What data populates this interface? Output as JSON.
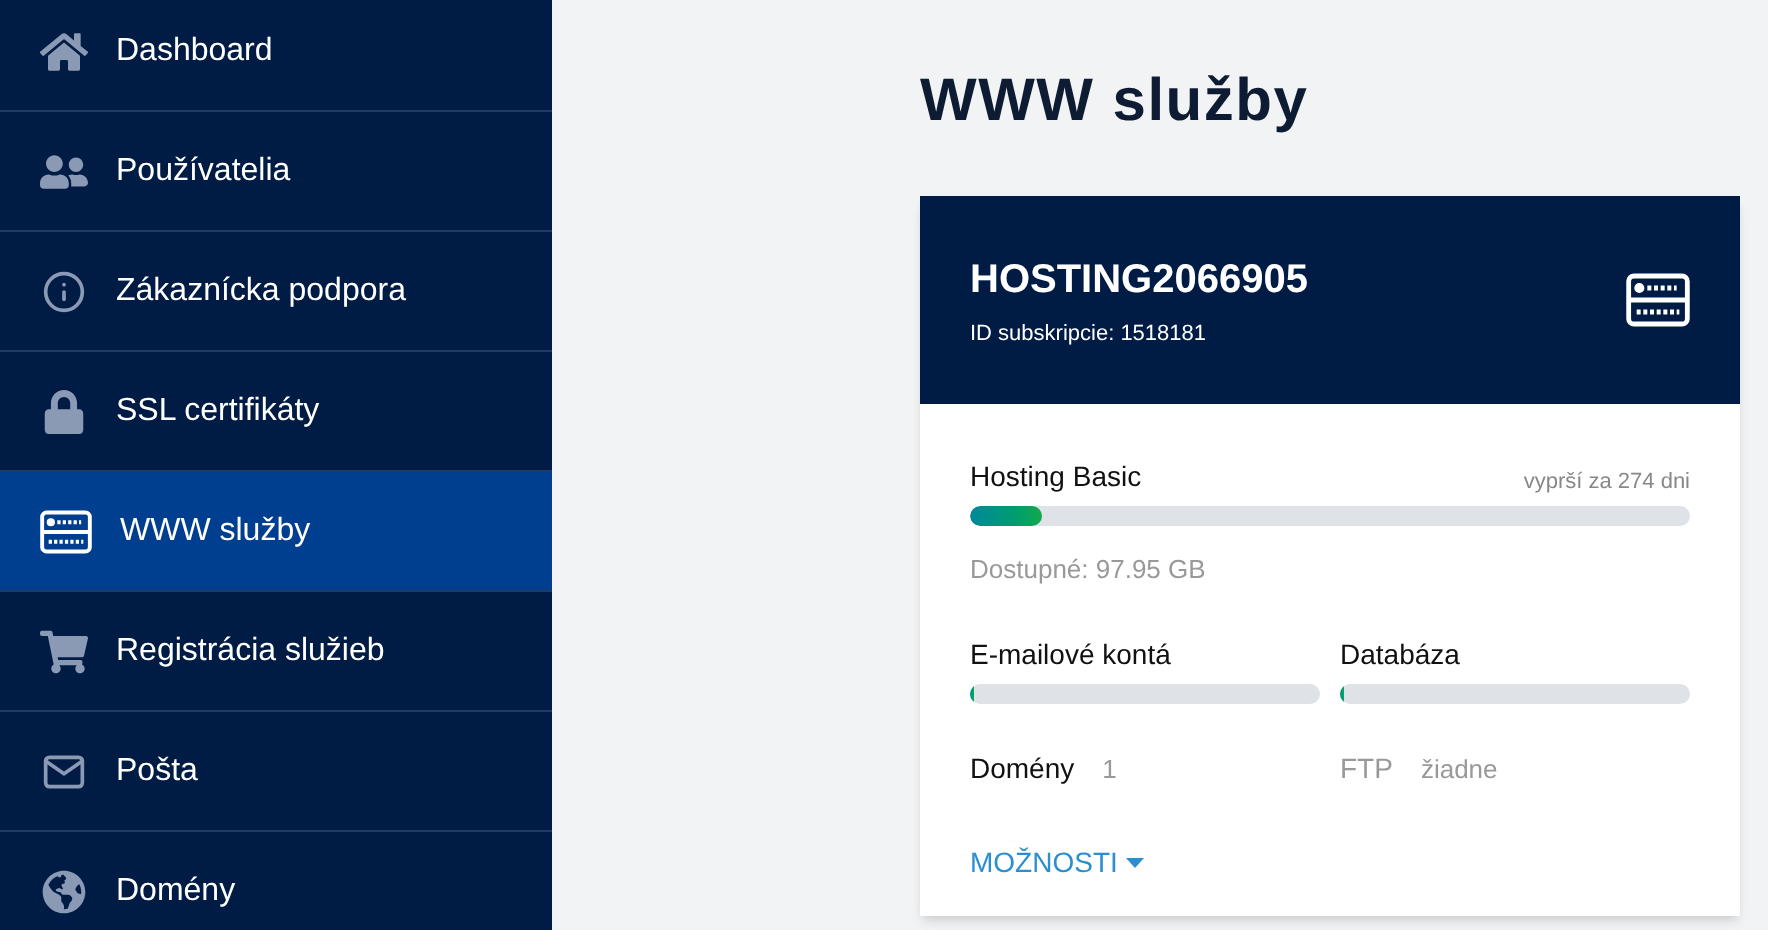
{
  "sidebar": {
    "items": [
      {
        "label": "Dashboard",
        "selected": false
      },
      {
        "label": "Používatelia",
        "selected": false
      },
      {
        "label": "Zákaznícka podpora",
        "selected": false
      },
      {
        "label": "SSL certifikáty",
        "selected": false
      },
      {
        "label": "WWW služby",
        "selected": true
      },
      {
        "label": "Registrácia služieb",
        "selected": false
      },
      {
        "label": "Pošta",
        "selected": false
      },
      {
        "label": "Domény",
        "selected": false
      }
    ]
  },
  "page_title": "WWW služby",
  "card": {
    "name": "HOSTING2066905",
    "subtitle": "ID subskripcie: 1518181",
    "plan": {
      "label": "Hosting Basic",
      "expiry": "vyprší za 274 dni",
      "level": 0.1,
      "available": "Dostupné: 97.95 GB"
    },
    "meters": [
      {
        "label": "E-mailové kontá",
        "level": 0.005
      },
      {
        "label": "Databáza",
        "level": 0.005
      }
    ],
    "stats": [
      {
        "label": "Domény",
        "value": "1",
        "disabled": false
      },
      {
        "label": "FTP",
        "value": "žiadne",
        "disabled": true
      }
    ],
    "options": "MOŽNOSTI"
  }
}
